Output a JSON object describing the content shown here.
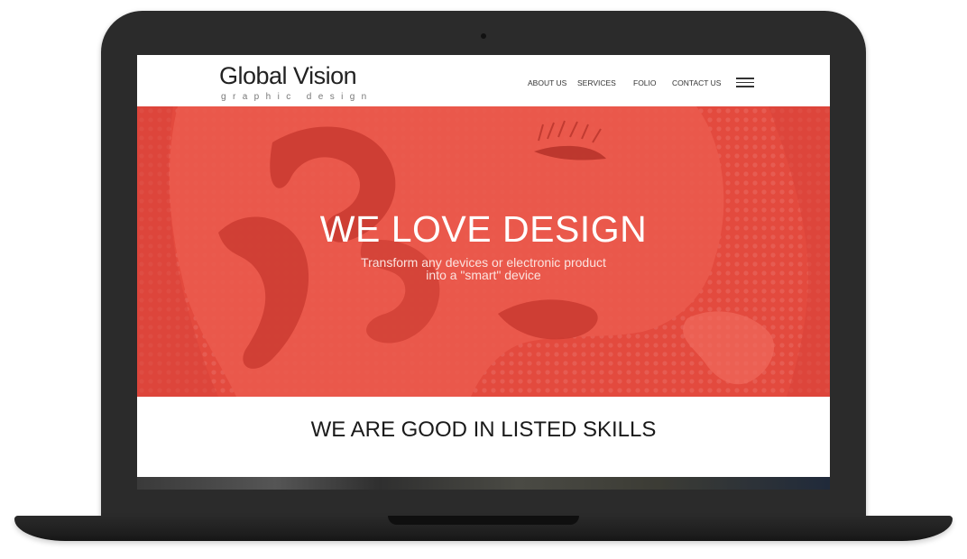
{
  "header": {
    "logo_title": "Global Vision",
    "logo_subtitle": "graphic design",
    "nav": [
      {
        "label": "ABOUT US"
      },
      {
        "label": "SERVICES"
      },
      {
        "label": "FOLIO"
      },
      {
        "label": "CONTACT US"
      }
    ],
    "menu_icon": "hamburger-icon"
  },
  "hero": {
    "title": "WE LOVE DESIGN",
    "subtitle_line1": "Transform any devices or electronic product",
    "subtitle_line2": "into a \"smart\" device",
    "background_color": "#e34a3e"
  },
  "skills": {
    "title": "WE ARE GOOD IN LISTED SKILLS"
  },
  "colors": {
    "bezel": "#2b2b2b",
    "accent": "#e34a3e"
  }
}
